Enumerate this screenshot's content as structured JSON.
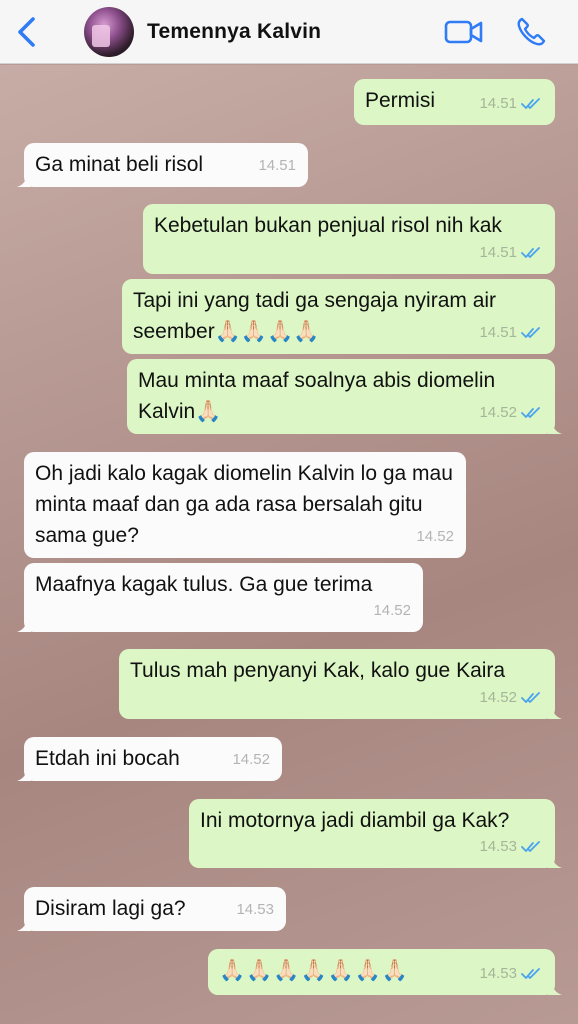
{
  "header": {
    "contact_name": "Temennya Kalvin",
    "back_icon": "chevron-left-icon",
    "video_icon": "video-camera-icon",
    "phone_icon": "phone-icon",
    "accent_color": "#2f7cf6"
  },
  "messages": [
    {
      "direction": "out",
      "text": "Permisi",
      "time": "14.51",
      "status": "read"
    },
    {
      "direction": "in",
      "text": "Ga minat beli risol",
      "time": "14.51"
    },
    {
      "direction": "out",
      "text": "Kebetulan bukan penjual risol nih kak",
      "time": "14.51",
      "status": "read"
    },
    {
      "direction": "out",
      "text": "Tapi ini yang tadi ga sengaja nyiram air seember🙏🏻🙏🏻🙏🏻🙏🏻",
      "time": "14.51",
      "status": "read"
    },
    {
      "direction": "out",
      "text": "Mau minta maaf soalnya abis diomelin Kalvin🙏🏻",
      "time": "14.52",
      "status": "read"
    },
    {
      "direction": "in",
      "text": "Oh jadi kalo kagak diomelin Kalvin lo ga mau minta maaf dan ga ada rasa bersalah gitu sama gue?",
      "time": "14.52"
    },
    {
      "direction": "in",
      "text": "Maafnya kagak tulus. Ga gue terima",
      "time": "14.52"
    },
    {
      "direction": "out",
      "text": "Tulus mah penyanyi Kak, kalo gue Kaira",
      "time": "14.52",
      "status": "read"
    },
    {
      "direction": "in",
      "text": "Etdah ini bocah",
      "time": "14.52"
    },
    {
      "direction": "out",
      "text": "Ini motornya jadi diambil ga Kak?",
      "time": "14.53",
      "status": "read"
    },
    {
      "direction": "in",
      "text": "Disiram lagi ga?",
      "time": "14.53"
    },
    {
      "direction": "out",
      "text": "🙏🏻🙏🏻🙏🏻🙏🏻🙏🏻🙏🏻🙏🏻",
      "time": "14.53",
      "status": "read"
    }
  ]
}
